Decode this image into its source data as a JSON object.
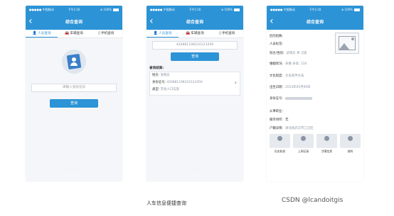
{
  "status": {
    "carrier": "●●●●● 中国移动",
    "time": "下午1:16",
    "battery": "⊕ 100%"
  },
  "nav": {
    "title": "综合查询",
    "back_icon": "chevron-left-icon"
  },
  "tabs": [
    {
      "label": "人员查询",
      "icon": "person-icon"
    },
    {
      "label": "车辆查询",
      "icon": "car-icon"
    },
    {
      "label": "手机查询",
      "icon": "phone-icon"
    }
  ],
  "screen1": {
    "placeholder": "请输入身份证号",
    "button": "查询"
  },
  "screen2": {
    "input_value": "420881198210123456",
    "button": "查询",
    "result_title": "查询结果:",
    "rows": [
      {
        "label": "姓名:",
        "value": "张晓东"
      },
      {
        "label": "身份证号:",
        "value": "420881198210123456"
      },
      {
        "label": "类型:",
        "value": "常住人口信息"
      }
    ]
  },
  "screen3": {
    "fields": [
      {
        "label": "危险指数:",
        "value": ""
      },
      {
        "label": "人员标签:",
        "value": ""
      },
      {
        "label": "别名/性别:",
        "value": "武晓东    男    汉族"
      },
      {
        "label": "婚姻状况:",
        "value": "未婚        身高: 110"
      },
      {
        "label": "文化程度:",
        "value": "文盲或半文盲"
      },
      {
        "label": "出生日期:",
        "value": "2014年05月09日"
      },
      {
        "label": "身份证号:",
        "value": ""
      },
      {
        "label": "从事职业:",
        "value": ""
      },
      {
        "label": "服务场所:",
        "value": "无"
      },
      {
        "label": "户籍详情:",
        "value": "湖北省武汉市江汉区"
      }
    ],
    "actions": [
      "历史轨迹",
      "上网记录",
      "涉案信息",
      "前科"
    ]
  },
  "caption": "人车信息便捷查询",
  "watermark": "CSDN @lcandoitgis",
  "colors": {
    "primary": "#2c93d6",
    "background": "#f4f6f9"
  }
}
